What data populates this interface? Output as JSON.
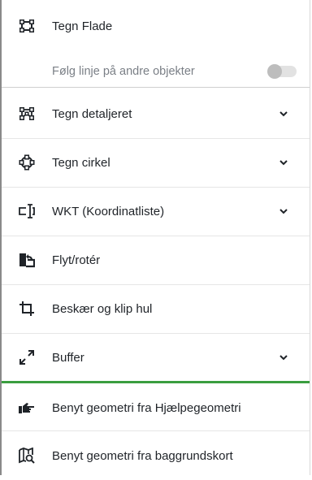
{
  "menu": {
    "items": [
      {
        "label": "Tegn Flade",
        "icon": "polygon-draw-icon"
      },
      {
        "label": "Følg linje på andre objekter",
        "icon": "",
        "toggle": false
      },
      {
        "label": "Tegn detaljeret",
        "icon": "polygon-detailed-icon",
        "chevron": "chevron-down-icon"
      },
      {
        "label": "Tegn cirkel",
        "icon": "circle-draw-icon",
        "chevron": "chevron-down-icon"
      },
      {
        "label": "WKT (Koordinatliste)",
        "icon": "text-cursor-icon",
        "chevron": "chevron-down-icon"
      },
      {
        "label": "Flyt/rotér",
        "icon": "move-rotate-icon"
      },
      {
        "label": "Beskær og klip hul",
        "icon": "crop-icon"
      },
      {
        "label": "Buffer",
        "icon": "expand-arrows-icon",
        "chevron": "chevron-down-icon"
      },
      {
        "label": "Benyt geometri fra Hjælpegeometri",
        "icon": "hand-point-icon"
      },
      {
        "label": "Benyt geometri fra baggrundskort",
        "icon": "map-search-icon"
      }
    ]
  },
  "colors": {
    "accent": "#3a9e3f",
    "text": "#1f2328",
    "muted": "#7a7f86"
  }
}
